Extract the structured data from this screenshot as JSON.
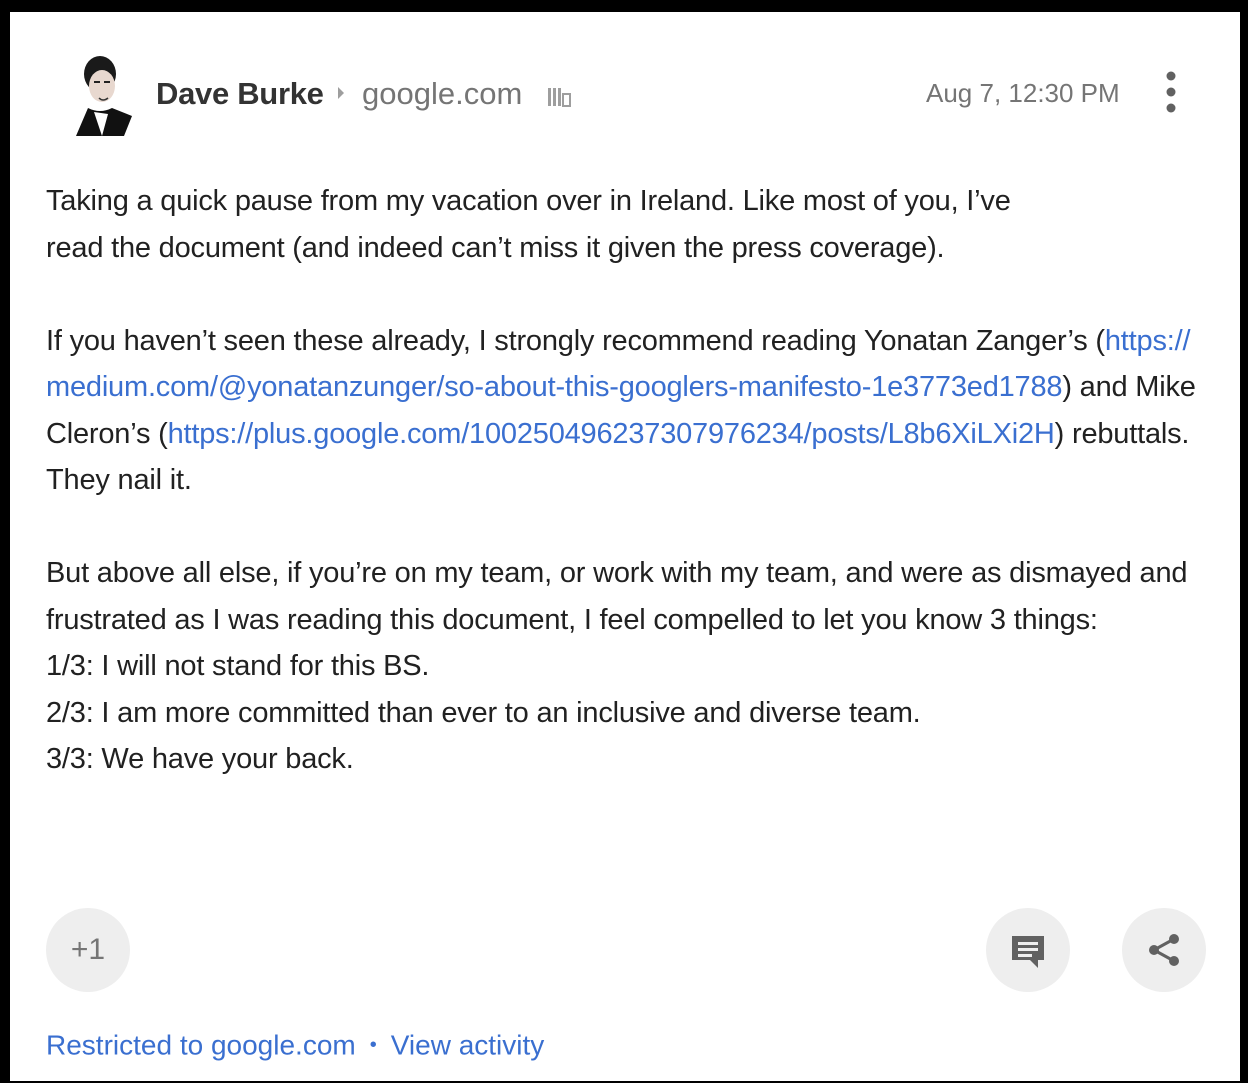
{
  "header": {
    "author": "Dave Burke",
    "domain": "google.com",
    "timestamp": "Aug 7, 12:30 PM"
  },
  "body": {
    "p1_line1": "Taking a quick pause from my vacation over in Ireland. Like most of you, I’ve",
    "p1_line2": "read the document (and indeed can’t miss it given the press coverage).",
    "p2_text1": "If you haven’t seen these already, I strongly recommend reading Yonatan Zanger’s (",
    "p2_link1": "https://medium.com/@yonatanzunger/so-about-this-googlers-manifesto-1e3773ed1788",
    "p2_text2": ") and Mike Cleron’s (",
    "p2_link2": "https://plus.google.com/100250496237307976234/posts/L8b6XiLXi2H",
    "p2_text3": ") rebuttals. They nail it.",
    "p3_intro": "But above all else, if you’re on my team, or work with my team, and were as dismayed and frustrated as I was reading this document, I feel compelled to let you know 3 things:",
    "item1": "1/3: I will not stand for this BS.",
    "item2": "2/3: I am more committed than ever to an inclusive and diverse team.",
    "item3": "3/3: We have your back."
  },
  "actions": {
    "plus_one": "+1",
    "comment_icon": "comment-icon",
    "share_icon": "share-icon"
  },
  "footer": {
    "restricted": "Restricted to google.com",
    "separator": "•",
    "view_activity": "View activity"
  },
  "colors": {
    "link": "#3a6fd0",
    "button_bg": "#eeeeee",
    "muted": "#757575"
  }
}
